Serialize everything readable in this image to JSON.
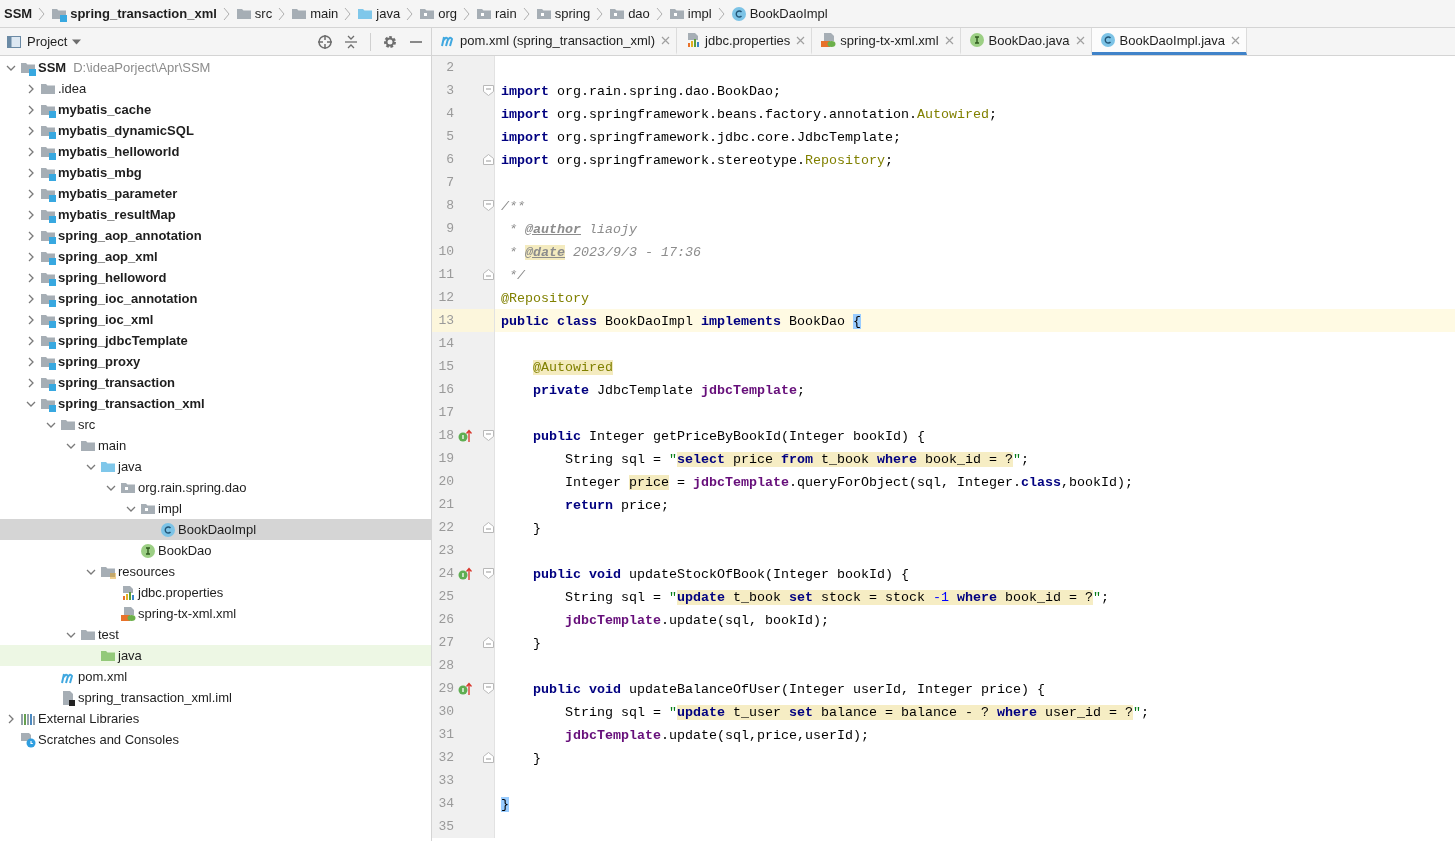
{
  "breadcrumbs": [
    {
      "label": "SSM",
      "kind": "root"
    },
    {
      "label": "spring_transaction_xml",
      "kind": "module"
    },
    {
      "label": "src",
      "kind": "folder"
    },
    {
      "label": "main",
      "kind": "folder"
    },
    {
      "label": "java",
      "kind": "source"
    },
    {
      "label": "org",
      "kind": "package"
    },
    {
      "label": "rain",
      "kind": "package"
    },
    {
      "label": "spring",
      "kind": "package"
    },
    {
      "label": "dao",
      "kind": "package"
    },
    {
      "label": "impl",
      "kind": "package"
    },
    {
      "label": "BookDaoImpl",
      "kind": "class"
    }
  ],
  "project_panel": {
    "title": "Project",
    "tree": [
      {
        "label": "SSM",
        "path": "D:\\ideaPorject\\Apr\\SSM",
        "kind": "module",
        "expanded": true,
        "selected": false,
        "hovered": false,
        "children": [
          {
            "label": ".idea",
            "kind": "folder",
            "expanded": false,
            "selected": false,
            "hovered": false
          },
          {
            "label": "mybatis_cache",
            "kind": "module",
            "expanded": false,
            "selected": false,
            "hovered": false
          },
          {
            "label": "mybatis_dynamicSQL",
            "kind": "module",
            "expanded": false,
            "selected": false,
            "hovered": false
          },
          {
            "label": "mybatis_helloworld",
            "kind": "module",
            "expanded": false,
            "selected": false,
            "hovered": false
          },
          {
            "label": "mybatis_mbg",
            "kind": "module",
            "expanded": false,
            "selected": false,
            "hovered": false
          },
          {
            "label": "mybatis_parameter",
            "kind": "module",
            "expanded": false,
            "selected": false,
            "hovered": false
          },
          {
            "label": "mybatis_resultMap",
            "kind": "module",
            "expanded": false,
            "selected": false,
            "hovered": false
          },
          {
            "label": "spring_aop_annotation",
            "kind": "module",
            "expanded": false,
            "selected": false,
            "hovered": false
          },
          {
            "label": "spring_aop_xml",
            "kind": "module",
            "expanded": false,
            "selected": false,
            "hovered": false
          },
          {
            "label": "spring_helloword",
            "kind": "module",
            "expanded": false,
            "selected": false,
            "hovered": false
          },
          {
            "label": "spring_ioc_annotation",
            "kind": "module",
            "expanded": false,
            "selected": false,
            "hovered": false
          },
          {
            "label": "spring_ioc_xml",
            "kind": "module",
            "expanded": false,
            "selected": false,
            "hovered": false
          },
          {
            "label": "spring_jdbcTemplate",
            "kind": "module",
            "expanded": false,
            "selected": false,
            "hovered": false
          },
          {
            "label": "spring_proxy",
            "kind": "module",
            "expanded": false,
            "selected": false,
            "hovered": false
          },
          {
            "label": "spring_transaction",
            "kind": "module",
            "expanded": false,
            "selected": false,
            "hovered": false
          },
          {
            "label": "spring_transaction_xml",
            "kind": "module",
            "expanded": true,
            "selected": false,
            "hovered": false,
            "children": [
              {
                "label": "src",
                "kind": "folder",
                "expanded": true,
                "selected": false,
                "hovered": false,
                "children": [
                  {
                    "label": "main",
                    "kind": "folder",
                    "expanded": true,
                    "selected": false,
                    "hovered": false,
                    "children": [
                      {
                        "label": "java",
                        "kind": "source",
                        "expanded": true,
                        "selected": false,
                        "hovered": false,
                        "children": [
                          {
                            "label": "org.rain.spring.dao",
                            "kind": "package",
                            "expanded": true,
                            "selected": false,
                            "hovered": false,
                            "children": [
                              {
                                "label": "impl",
                                "kind": "package",
                                "expanded": true,
                                "selected": false,
                                "hovered": false,
                                "children": [
                                  {
                                    "label": "BookDaoImpl",
                                    "kind": "class",
                                    "selected": true,
                                    "hovered": false
                                  }
                                ]
                              },
                              {
                                "label": "BookDao",
                                "kind": "interface",
                                "selected": false,
                                "hovered": false
                              }
                            ]
                          }
                        ]
                      },
                      {
                        "label": "resources",
                        "kind": "resources",
                        "expanded": true,
                        "selected": false,
                        "hovered": false,
                        "children": [
                          {
                            "label": "jdbc.properties",
                            "kind": "properties",
                            "selected": false,
                            "hovered": false
                          },
                          {
                            "label": "spring-tx-xml.xml",
                            "kind": "xml",
                            "selected": false,
                            "hovered": false
                          }
                        ]
                      }
                    ]
                  },
                  {
                    "label": "test",
                    "kind": "folder",
                    "expanded": true,
                    "selected": false,
                    "hovered": false,
                    "children": [
                      {
                        "label": "java",
                        "kind": "test-source",
                        "selected": false,
                        "hovered": true
                      }
                    ]
                  }
                ]
              },
              {
                "label": "pom.xml",
                "kind": "maven",
                "selected": false,
                "hovered": false
              },
              {
                "label": "spring_transaction_xml.iml",
                "kind": "iml",
                "selected": false,
                "hovered": false
              }
            ]
          }
        ]
      },
      {
        "label": "External Libraries",
        "kind": "libraries",
        "expanded": false,
        "selected": false,
        "hovered": false
      },
      {
        "label": "Scratches and Consoles",
        "kind": "scratches",
        "selected": false,
        "hovered": false
      }
    ]
  },
  "editor_tabs": [
    {
      "label": "pom.xml (spring_transaction_xml)",
      "kind": "maven",
      "selected": false
    },
    {
      "label": "jdbc.properties",
      "kind": "properties",
      "selected": false
    },
    {
      "label": "spring-tx-xml.xml",
      "kind": "xml",
      "selected": false
    },
    {
      "label": "BookDao.java",
      "kind": "interface",
      "selected": false
    },
    {
      "label": "BookDaoImpl.java",
      "kind": "class",
      "selected": true
    }
  ],
  "editor": {
    "lines": [
      {
        "n": "2",
        "current": false,
        "implements": false
      },
      {
        "n": "3",
        "current": false,
        "implements": false,
        "kind": "top",
        "folding": {
          "kind": "start"
        },
        "tokens": [
          {
            "text": "import",
            "kind": "keyword"
          },
          {
            "text": " org.rain.spring.dao.BookDao;",
            "kind": "plain"
          }
        ]
      },
      {
        "n": "4",
        "current": false,
        "implements": false,
        "kind": "top",
        "tokens": [
          {
            "text": "import",
            "kind": "keyword"
          },
          {
            "text": " org.springframework.beans.factory.annotation.",
            "kind": "plain"
          },
          {
            "text": "Autowired",
            "kind": "annotation"
          },
          {
            "text": ";",
            "kind": "plain"
          }
        ]
      },
      {
        "n": "5",
        "current": false,
        "implements": false,
        "kind": "top",
        "tokens": [
          {
            "text": "import",
            "kind": "keyword"
          },
          {
            "text": " org.springframework.jdbc.core.JdbcTemplate;",
            "kind": "plain"
          }
        ]
      },
      {
        "n": "6",
        "current": false,
        "implements": false,
        "kind": "top",
        "folding": {
          "kind": "end"
        },
        "tokens": [
          {
            "text": "import",
            "kind": "keyword"
          },
          {
            "text": " org.springframework.stereotype.",
            "kind": "plain"
          },
          {
            "text": "Repository",
            "kind": "annotation"
          },
          {
            "text": ";",
            "kind": "plain"
          }
        ]
      },
      {
        "n": "7",
        "current": false,
        "implements": false
      },
      {
        "n": "8",
        "current": false,
        "implements": false,
        "kind": "top",
        "folding": {
          "kind": "start"
        },
        "tokens": [
          {
            "text": "/**",
            "kind": "doc"
          }
        ]
      },
      {
        "n": "9",
        "current": false,
        "implements": false,
        "kind": "top",
        "tokens": [
          {
            "text": " * ",
            "kind": "doc"
          },
          {
            "text": "@author",
            "kind": "doc-tag"
          },
          {
            "text": " liaojy",
            "kind": "doc"
          }
        ]
      },
      {
        "n": "10",
        "current": false,
        "implements": false,
        "kind": "top",
        "tokens": [
          {
            "text": " * ",
            "kind": "doc"
          },
          {
            "text": "@date",
            "kind": "doc-tag-usage"
          },
          {
            "text": " 2023/9/3 - 17:36",
            "kind": "doc"
          }
        ]
      },
      {
        "n": "11",
        "current": false,
        "implements": false,
        "kind": "top",
        "folding": {
          "kind": "end"
        },
        "tokens": [
          {
            "text": " */",
            "kind": "doc"
          }
        ]
      },
      {
        "n": "12",
        "current": false,
        "implements": false,
        "kind": "top",
        "tokens": [
          {
            "text": "@Repository",
            "kind": "annotation"
          }
        ]
      },
      {
        "n": "13",
        "current": true,
        "implements": false,
        "kind": "top",
        "tokens": [
          {
            "text": "public class",
            "kind": "keyword"
          },
          {
            "text": " BookDaoImpl ",
            "kind": "plain"
          },
          {
            "text": "implements",
            "kind": "keyword"
          },
          {
            "text": " BookDao ",
            "kind": "plain"
          },
          {
            "text": "{",
            "kind": "brace-match"
          }
        ]
      },
      {
        "n": "14",
        "current": false,
        "implements": false
      },
      {
        "n": "15",
        "current": false,
        "implements": false,
        "kind": "member",
        "tokens": [
          {
            "text": "@Autowired",
            "kind": "annotation-usage"
          }
        ]
      },
      {
        "n": "16",
        "current": false,
        "implements": false,
        "kind": "member",
        "tokens": [
          {
            "text": "private",
            "kind": "keyword"
          },
          {
            "text": " JdbcTemplate ",
            "kind": "plain"
          },
          {
            "text": "jdbcTemplate",
            "kind": "field"
          },
          {
            "text": ";",
            "kind": "plain"
          }
        ]
      },
      {
        "n": "17",
        "current": false,
        "implements": false
      },
      {
        "n": "18",
        "current": false,
        "implements": true,
        "kind": "member",
        "folding": {
          "kind": "start"
        },
        "tokens": [
          {
            "text": "public",
            "kind": "keyword"
          },
          {
            "text": " Integer getPriceByBookId(Integer bookId) {",
            "kind": "plain"
          }
        ]
      },
      {
        "n": "19",
        "current": false,
        "implements": false,
        "kind": "statement",
        "tokens": [
          {
            "text": "String sql = ",
            "kind": "plain"
          },
          {
            "text": "\"",
            "kind": "quote"
          },
          {
            "text": "select",
            "kind": "sql-keyword"
          },
          {
            "text": " price ",
            "kind": "sql"
          },
          {
            "text": "from",
            "kind": "sql-keyword"
          },
          {
            "text": " t_book ",
            "kind": "sql"
          },
          {
            "text": "where",
            "kind": "sql-keyword"
          },
          {
            "text": " book_id = ?",
            "kind": "sql"
          },
          {
            "text": "\"",
            "kind": "quote"
          },
          {
            "text": ";",
            "kind": "plain"
          }
        ]
      },
      {
        "n": "20",
        "current": false,
        "implements": false,
        "kind": "statement",
        "tokens": [
          {
            "text": "Integer ",
            "kind": "plain"
          },
          {
            "text": "price",
            "kind": "usage"
          },
          {
            "text": " = ",
            "kind": "plain"
          },
          {
            "text": "jdbcTemplate",
            "kind": "field"
          },
          {
            "text": ".queryForObject(sql, Integer.",
            "kind": "plain"
          },
          {
            "text": "class",
            "kind": "keyword"
          },
          {
            "text": ",bookId);",
            "kind": "plain"
          }
        ]
      },
      {
        "n": "21",
        "current": false,
        "implements": false,
        "kind": "statement",
        "tokens": [
          {
            "text": "return",
            "kind": "keyword"
          },
          {
            "text": " price;",
            "kind": "plain"
          }
        ]
      },
      {
        "n": "22",
        "current": false,
        "implements": false,
        "kind": "member",
        "folding": {
          "kind": "end"
        },
        "tokens": [
          {
            "text": "}",
            "kind": "plain"
          }
        ]
      },
      {
        "n": "23",
        "current": false,
        "implements": false
      },
      {
        "n": "24",
        "current": false,
        "implements": true,
        "kind": "member",
        "folding": {
          "kind": "start"
        },
        "tokens": [
          {
            "text": "public void",
            "kind": "keyword"
          },
          {
            "text": " updateStockOfBook(Integer bookId) {",
            "kind": "plain"
          }
        ]
      },
      {
        "n": "25",
        "current": false,
        "implements": false,
        "kind": "statement",
        "tokens": [
          {
            "text": "String sql = ",
            "kind": "plain"
          },
          {
            "text": "\"",
            "kind": "quote"
          },
          {
            "text": "update",
            "kind": "sql-keyword"
          },
          {
            "text": " t_book ",
            "kind": "sql"
          },
          {
            "text": "set",
            "kind": "sql-keyword"
          },
          {
            "text": " stock = stock ",
            "kind": "sql"
          },
          {
            "text": "-1",
            "kind": "sql-number"
          },
          {
            "text": " where",
            "kind": "sql-keyword"
          },
          {
            "text": " book_id = ?",
            "kind": "sql"
          },
          {
            "text": "\"",
            "kind": "quote"
          },
          {
            "text": ";",
            "kind": "plain"
          }
        ]
      },
      {
        "n": "26",
        "current": false,
        "implements": false,
        "kind": "statement",
        "tokens": [
          {
            "text": "jdbcTemplate",
            "kind": "field"
          },
          {
            "text": ".update(sql, bookId);",
            "kind": "plain"
          }
        ]
      },
      {
        "n": "27",
        "current": false,
        "implements": false,
        "kind": "member",
        "folding": {
          "kind": "end"
        },
        "tokens": [
          {
            "text": "}",
            "kind": "plain"
          }
        ]
      },
      {
        "n": "28",
        "current": false,
        "implements": false
      },
      {
        "n": "29",
        "current": false,
        "implements": true,
        "kind": "member",
        "folding": {
          "kind": "start"
        },
        "tokens": [
          {
            "text": "public void",
            "kind": "keyword"
          },
          {
            "text": " updateBalanceOfUser(Integer userId, Integer price) {",
            "kind": "plain"
          }
        ]
      },
      {
        "n": "30",
        "current": false,
        "implements": false,
        "kind": "statement",
        "tokens": [
          {
            "text": "String sql = ",
            "kind": "plain"
          },
          {
            "text": "\"",
            "kind": "quote"
          },
          {
            "text": "update",
            "kind": "sql-keyword"
          },
          {
            "text": " t_user ",
            "kind": "sql"
          },
          {
            "text": "set",
            "kind": "sql-keyword"
          },
          {
            "text": " balance = balance - ? ",
            "kind": "sql"
          },
          {
            "text": "where",
            "kind": "sql-keyword"
          },
          {
            "text": " user_id = ?",
            "kind": "sql"
          },
          {
            "text": "\"",
            "kind": "quote"
          },
          {
            "text": ";",
            "kind": "plain"
          }
        ]
      },
      {
        "n": "31",
        "current": false,
        "implements": false,
        "kind": "statement",
        "tokens": [
          {
            "text": "jdbcTemplate",
            "kind": "field"
          },
          {
            "text": ".update(sql,price,userId);",
            "kind": "plain"
          }
        ]
      },
      {
        "n": "32",
        "current": false,
        "implements": false,
        "kind": "member",
        "folding": {
          "kind": "end"
        },
        "tokens": [
          {
            "text": "}",
            "kind": "plain"
          }
        ]
      },
      {
        "n": "33",
        "current": false,
        "implements": false
      },
      {
        "n": "34",
        "current": false,
        "implements": false,
        "kind": "top",
        "tokens": [
          {
            "text": "}",
            "kind": "brace-match"
          }
        ]
      },
      {
        "n": "35",
        "current": false,
        "implements": false
      }
    ]
  }
}
